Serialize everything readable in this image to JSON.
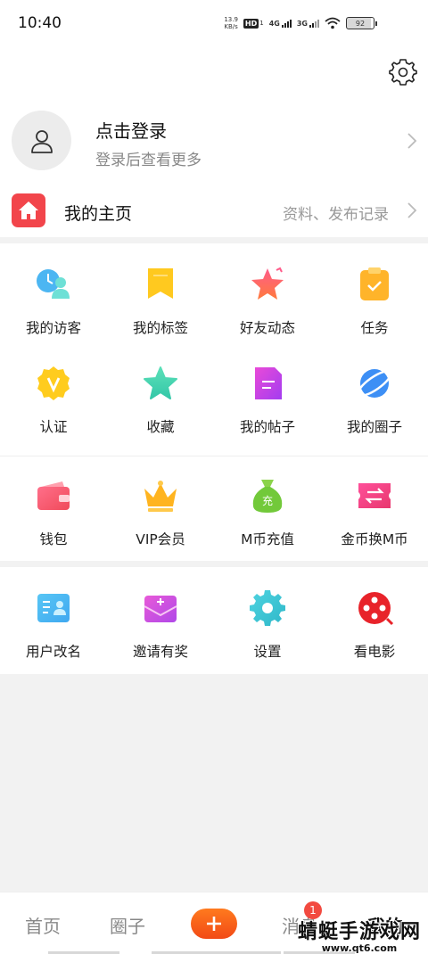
{
  "status_bar": {
    "time": "10:40",
    "net_speed_value": "13.9",
    "net_speed_unit": "KB/s",
    "hd": "HD",
    "hd_sub": "1",
    "signal1": "4G",
    "signal2": "3G",
    "battery": "92"
  },
  "profile": {
    "login_title": "点击登录",
    "login_subtitle": "登录后查看更多"
  },
  "homepage": {
    "title": "我的主页",
    "subtitle": "资料、发布记录"
  },
  "grid_section1": [
    {
      "label": "我的访客",
      "icon": "visitor-icon"
    },
    {
      "label": "我的标签",
      "icon": "bookmark-icon"
    },
    {
      "label": "好友动态",
      "icon": "star-icon"
    },
    {
      "label": "任务",
      "icon": "clipboard-icon"
    },
    {
      "label": "认证",
      "icon": "verify-badge-icon"
    },
    {
      "label": "收藏",
      "icon": "favorite-star-icon"
    },
    {
      "label": "我的帖子",
      "icon": "document-icon"
    },
    {
      "label": "我的圈子",
      "icon": "planet-icon"
    }
  ],
  "grid_section2": [
    {
      "label": "钱包",
      "icon": "wallet-icon"
    },
    {
      "label": "VIP会员",
      "icon": "crown-icon"
    },
    {
      "label": "M币充值",
      "icon": "money-bag-icon"
    },
    {
      "label": "金币换M币",
      "icon": "exchange-ticket-icon"
    }
  ],
  "grid_section3": [
    {
      "label": "用户改名",
      "icon": "id-card-icon"
    },
    {
      "label": "邀请有奖",
      "icon": "envelope-icon"
    },
    {
      "label": "设置",
      "icon": "gear-icon"
    },
    {
      "label": "看电影",
      "icon": "film-reel-icon"
    }
  ],
  "money_bag_char": "充",
  "tabbar": {
    "home": "首页",
    "circle": "圈子",
    "plus": "+",
    "message": "消息",
    "message_badge": "1",
    "mine": "我的"
  },
  "watermark": {
    "text": "蜻蜓手游戏网",
    "url": "www.qt6.com"
  },
  "colors": {
    "accent": "#f24a16",
    "home_icon": "#f2454b",
    "badge": "#f24a40"
  }
}
